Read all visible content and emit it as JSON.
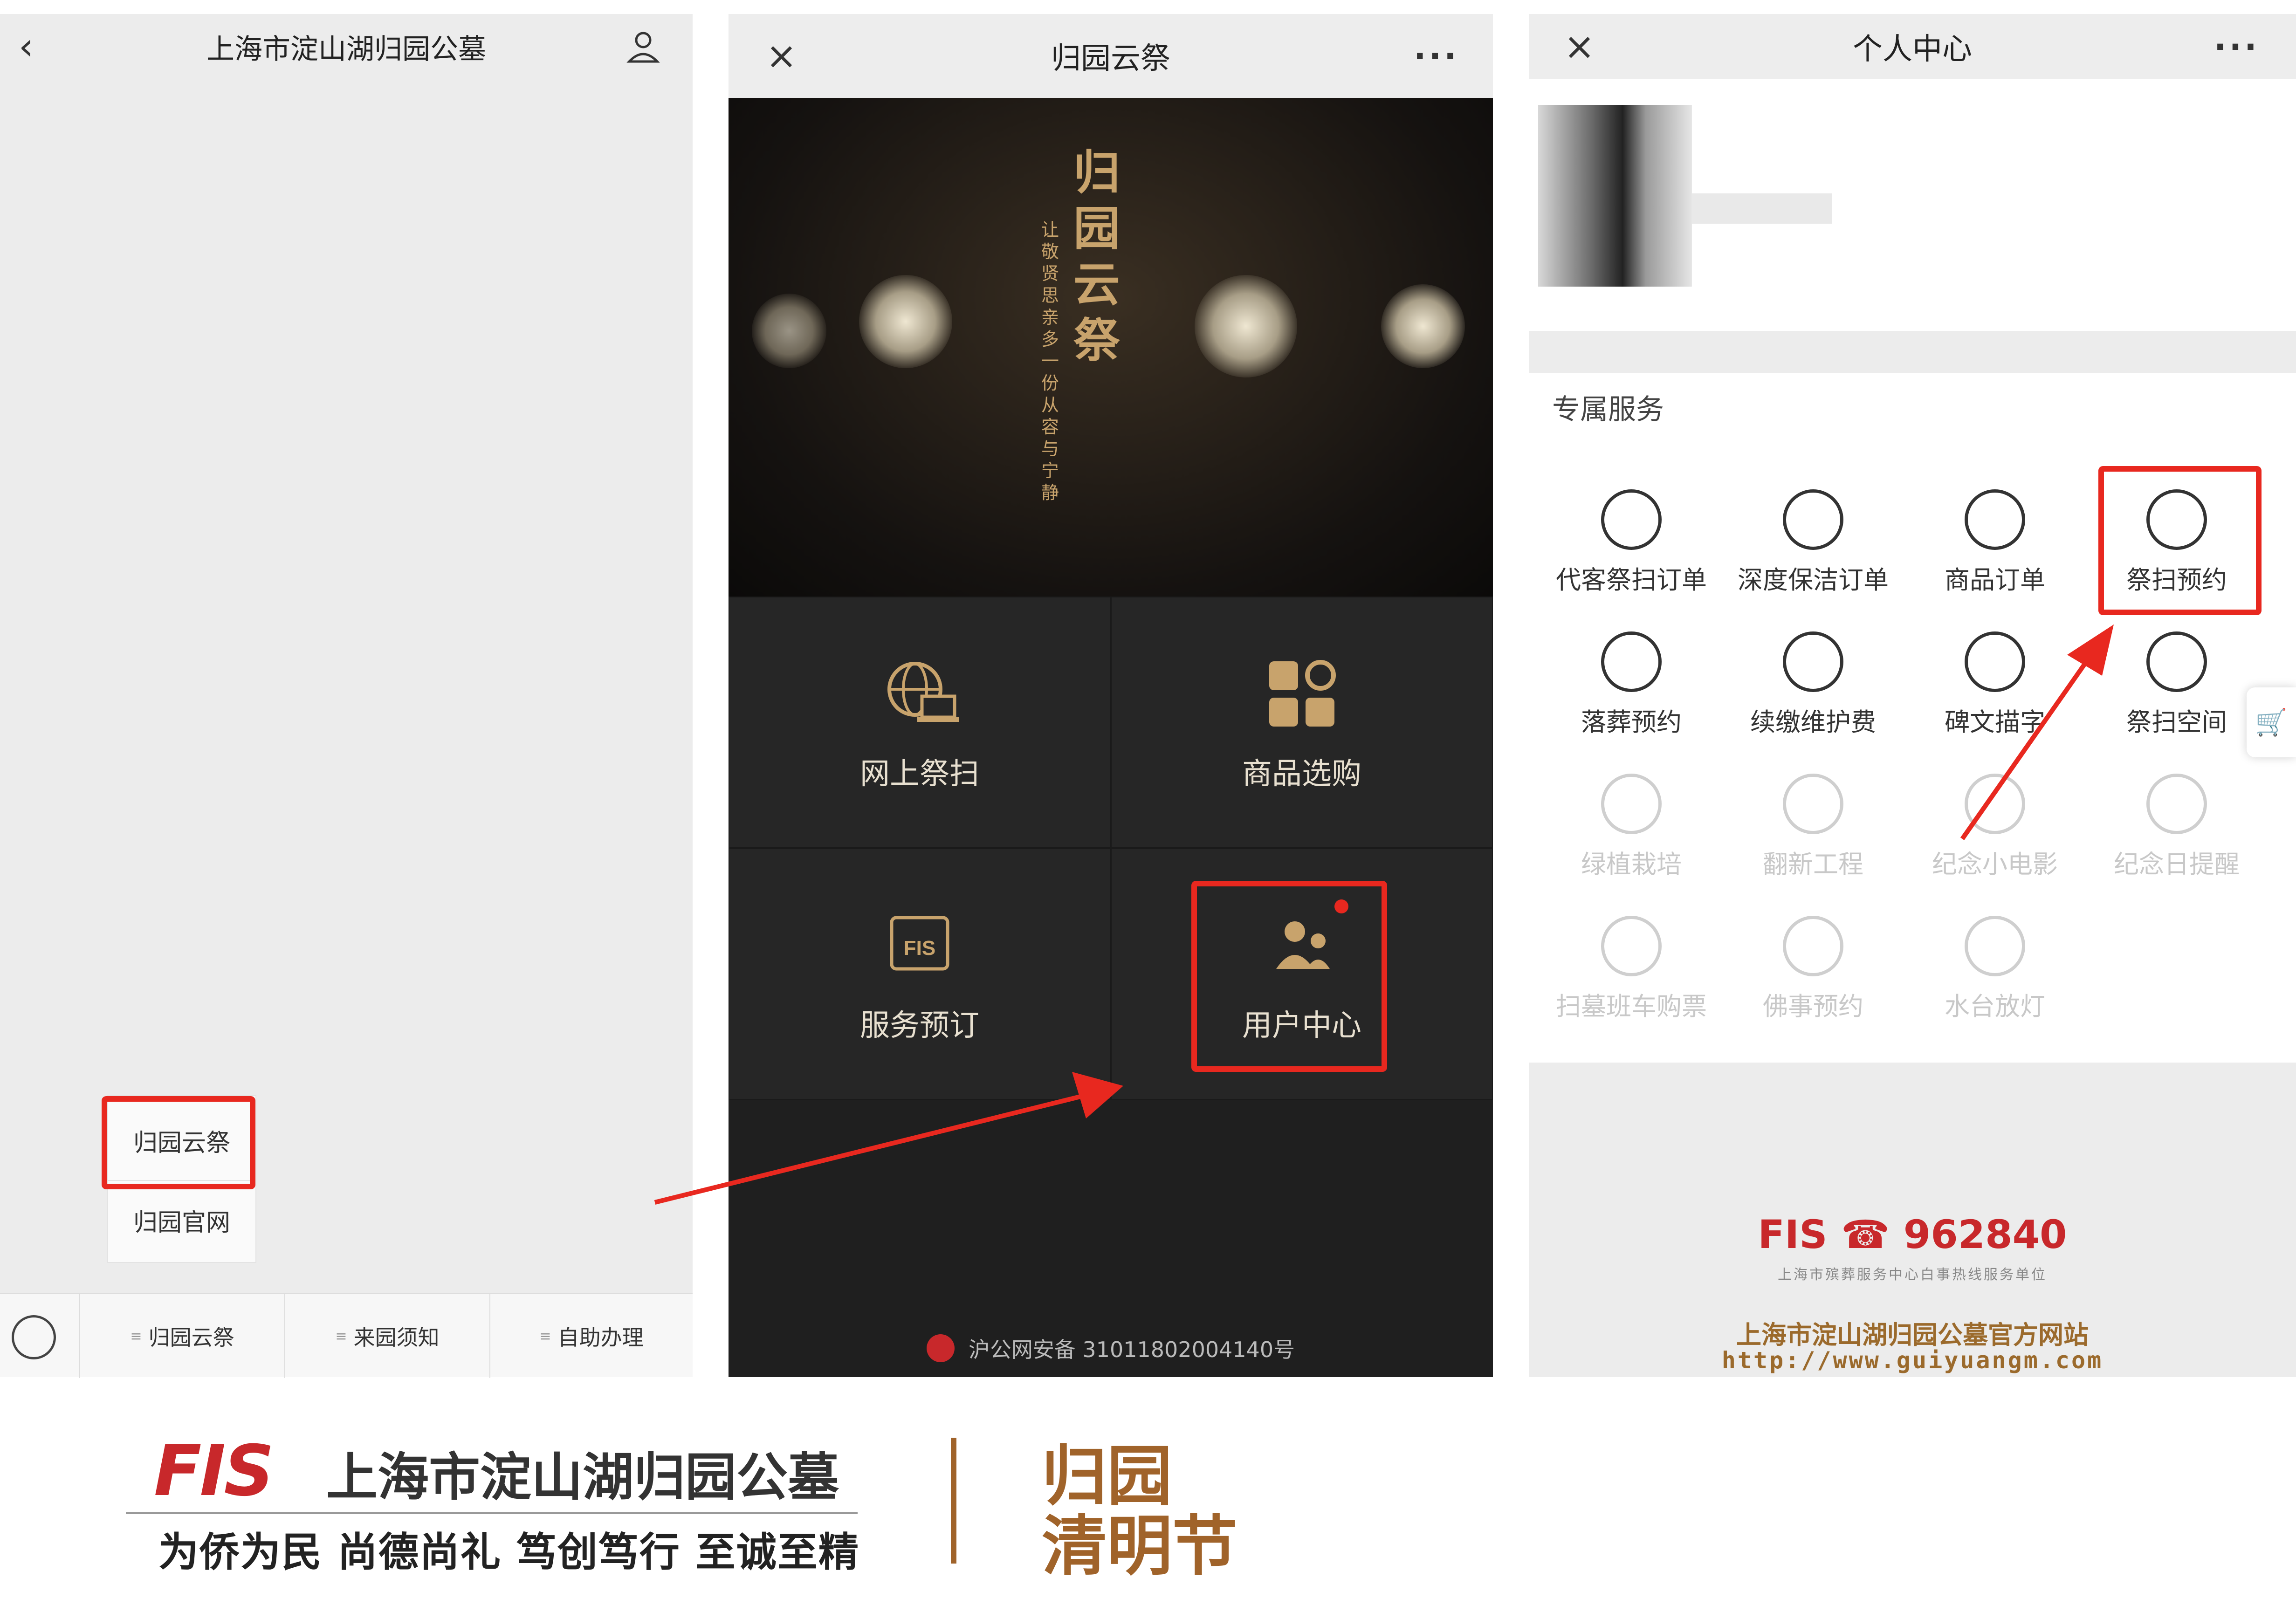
{
  "panel1": {
    "title": "上海市淀山湖归园公墓",
    "popup": [
      "归园云祭",
      "归园官网"
    ],
    "menu": [
      "归园云祭",
      "来园须知",
      "自助办理"
    ]
  },
  "panel2": {
    "title": "归园云祭",
    "hero_title": "归园云祭",
    "hero_subtitle": "让敬贤思亲多一份从容与宁静",
    "tiles": [
      "网上祭扫",
      "商品选购",
      "服务预订",
      "用户中心"
    ],
    "footer": "沪公网安备 31011802004140号"
  },
  "panel3": {
    "title": "个人中心",
    "section": "专属服务",
    "services": [
      {
        "label": "代客祭扫订单",
        "icon": "person-leaf-icon",
        "enabled": true
      },
      {
        "label": "深度保洁订单",
        "icon": "house-clean-icon",
        "enabled": true
      },
      {
        "label": "商品订单",
        "icon": "cart-icon",
        "enabled": true
      },
      {
        "label": "祭扫预约",
        "icon": "wreath-icon",
        "enabled": true
      },
      {
        "label": "落葬预约",
        "icon": "tombstone-icon",
        "enabled": true
      },
      {
        "label": "续缴维护费",
        "icon": "document-icon",
        "enabled": true
      },
      {
        "label": "碑文描字",
        "icon": "stele-icon",
        "enabled": true
      },
      {
        "label": "祭扫空间",
        "icon": "person-icon",
        "enabled": true
      },
      {
        "label": "绿植栽培",
        "icon": "plant-icon",
        "enabled": false
      },
      {
        "label": "翻新工程",
        "icon": "gear-icon",
        "enabled": false
      },
      {
        "label": "纪念小电影",
        "icon": "film-icon",
        "enabled": false
      },
      {
        "label": "纪念日提醒",
        "icon": "calendar-icon",
        "enabled": false
      },
      {
        "label": "扫墓班车购票",
        "icon": "ticket-icon",
        "enabled": false
      },
      {
        "label": "佛事预约",
        "icon": "book-icon",
        "enabled": false
      },
      {
        "label": "水台放灯",
        "icon": "lantern-icon",
        "enabled": false
      }
    ],
    "footer": {
      "logo": "FIS",
      "hotline": "962840",
      "hotline_sub": "上海市殡葬服务中心白事热线服务单位",
      "site_title": "上海市淀山湖归园公墓官方网站",
      "site_url": "http://www.guiyuangm.com"
    }
  },
  "branding": {
    "logo": "FIS",
    "name": "上海市淀山湖归园公墓",
    "slogan": "为侨为民 尚德尚礼 笃创笃行 至诚至精",
    "right_line1": "归园",
    "right_line2": "清明节"
  },
  "colors": {
    "highlight": "#e8281f",
    "brand_red": "#c8282b",
    "brand_brown": "#a0632a",
    "gold": "#c8a36c"
  }
}
